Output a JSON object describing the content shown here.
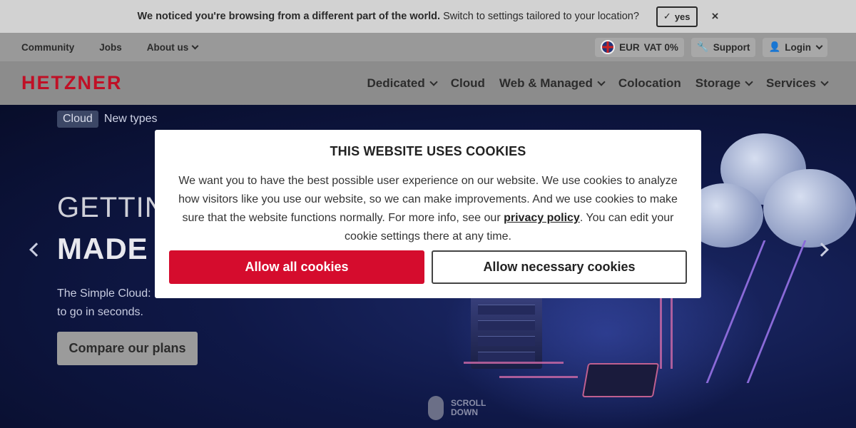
{
  "notice": {
    "strong": "We noticed you're browsing from a different part of the world.",
    "text": "Switch to settings tailored to your location?",
    "yes_label": "yes",
    "close_label": "×"
  },
  "metabar": {
    "links": [
      "Community",
      "Jobs",
      "About us"
    ],
    "currency": "EUR",
    "vat": "VAT 0%",
    "support": "Support",
    "login": "Login"
  },
  "nav": {
    "logo": "HETZNER",
    "items": [
      "Dedicated",
      "Cloud",
      "Web & Managed",
      "Colocation",
      "Storage",
      "Services"
    ]
  },
  "hero": {
    "tag": "Cloud",
    "tag_text": "New types",
    "heading_line1": "GETTIN",
    "heading_line2": "MADE",
    "lead_line1": "The Simple Cloud:",
    "lead_line2": "to go in seconds.",
    "cta": "Compare our plans",
    "scroll_line1": "SCROLL",
    "scroll_line2": "DOWN"
  },
  "cookie": {
    "title": "THIS WEBSITE USES COOKIES",
    "body_before": "We want you to have the best possible user experience on our website. We use cookies to analyze how visitors like you use our website, so we can make improvements. And we use cookies to make sure that the website functions normally. For more info, see our ",
    "link": "privacy policy",
    "body_after": ". You can edit your cookie settings there at any time.",
    "allow_all": "Allow all cookies",
    "allow_necessary": "Allow necessary cookies"
  },
  "colors": {
    "brand_red": "#d50c2d",
    "logo_red": "#c01026"
  }
}
